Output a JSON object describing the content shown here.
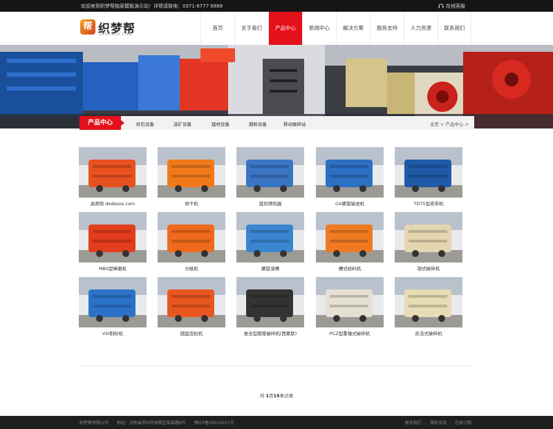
{
  "topbar": {
    "welcome": "欢迎来到织梦帮独家模板演示站！详情请致电：0371-6777 6888",
    "service": "在线客服"
  },
  "logo": {
    "mark": "帮",
    "name": "织梦帮",
    "sub": "DEDESOS.COM"
  },
  "nav": [
    {
      "label": "首页"
    },
    {
      "label": "关于我们"
    },
    {
      "label": "产品中心",
      "active": true
    },
    {
      "label": "新闻中心"
    },
    {
      "label": "解决方案"
    },
    {
      "label": "服务支持"
    },
    {
      "label": "人力资源"
    },
    {
      "label": "联系我们"
    }
  ],
  "subbar": {
    "label": "产品中心",
    "categories": [
      "砂石设备",
      "选矿设备",
      "建材设备",
      "磨粉设备",
      "移动破碎站"
    ],
    "breadcrumb": "主页 > 产品中心 >"
  },
  "products": [
    {
      "name": "高频筛 dedesos.com",
      "color": "#e8511f"
    },
    {
      "name": "烘干机",
      "color": "#f07a1a"
    },
    {
      "name": "旋风预热器",
      "color": "#3a75c4"
    },
    {
      "name": "GX螺旋输送机",
      "color": "#2d6fc2"
    },
    {
      "name": "TD75型皮带机",
      "color": "#1e5aa8"
    },
    {
      "name": "MBS型棒磨机",
      "color": "#e23d1c"
    },
    {
      "name": "分级机",
      "color": "#ee6a1c"
    },
    {
      "name": "螺旋溜槽",
      "color": "#3a85d0"
    },
    {
      "name": "槽式给料机",
      "color": "#ef7a22"
    },
    {
      "name": "颚式破碎机",
      "color": "#e3d6b0"
    },
    {
      "name": "VSI制砂机",
      "color": "#2b73c8"
    },
    {
      "name": "圆盘造粒机",
      "color": "#e8571f"
    },
    {
      "name": "复合型圆锥破碎机(西蒙斯)",
      "color": "#333333"
    },
    {
      "name": "PCZ型重锤式破碎机",
      "color": "#e6e0d4"
    },
    {
      "name": "反击式破碎机",
      "color": "#e8dcb6"
    }
  ],
  "pager": {
    "prefix": "共 ",
    "pages": "1",
    "mid": "页",
    "records": "15",
    "suffix": "条记录"
  },
  "footer": {
    "copy": "织梦帮有限公司　　地址：河南省郑州市高新区某某路8号　　豫ICP备09016551号",
    "links": [
      "联系我们",
      "服务支持",
      "在线订购"
    ]
  },
  "colors": {
    "accent": "#e4101a",
    "topbar": "#151515",
    "footer": "#1f1f1f"
  }
}
